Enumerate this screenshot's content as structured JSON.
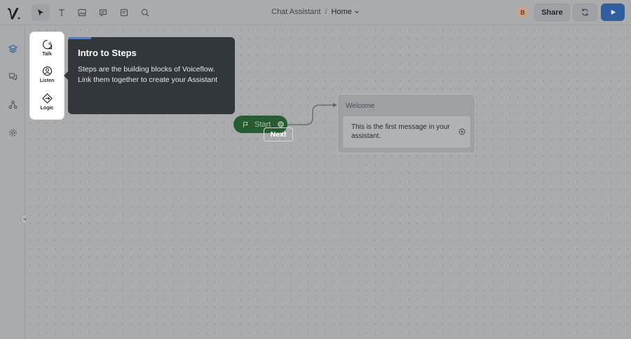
{
  "header": {
    "tools": [
      {
        "name": "select-tool",
        "icon": "cursor-icon",
        "active": true
      },
      {
        "name": "text-tool",
        "icon": "text-icon",
        "active": false
      },
      {
        "name": "image-tool",
        "icon": "image-icon",
        "active": false
      },
      {
        "name": "comment-tool",
        "icon": "comment-icon",
        "active": false
      },
      {
        "name": "note-tool",
        "icon": "note-icon",
        "active": false
      },
      {
        "name": "search-tool",
        "icon": "search-icon",
        "active": false
      }
    ],
    "breadcrumb": {
      "project": "Chat Assistant",
      "separator": "/",
      "current": "Home"
    },
    "avatar_initial": "B",
    "share_label": "Share"
  },
  "rail": {
    "icons": [
      "layers-icon",
      "chat-icon",
      "flow-icon",
      "settings-icon"
    ]
  },
  "palette": {
    "steps": [
      {
        "label": "Talk",
        "icon": "talk-icon"
      },
      {
        "label": "Listen",
        "icon": "listen-icon"
      },
      {
        "label": "Logic",
        "icon": "logic-icon"
      }
    ]
  },
  "tooltip": {
    "title": "Intro to Steps",
    "body": "Steps are the building blocks of Voiceflow. Link them together to create your Assistant",
    "next_label": "Next",
    "progress": 0.14
  },
  "canvas": {
    "start_label": "Start",
    "block": {
      "title": "Welcome",
      "message": "This is the first message in your assistant."
    }
  },
  "colors": {
    "accent": "#2f5f9f",
    "start_node": "#275b31",
    "tooltip_bg": "#32373c",
    "progress": "#3d82e6"
  }
}
